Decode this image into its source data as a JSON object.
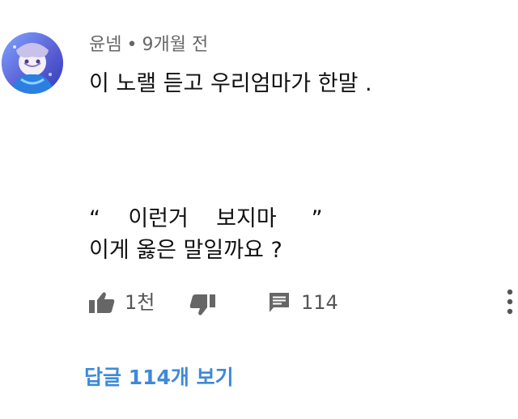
{
  "comment": {
    "author": "윤넴",
    "separator": "•",
    "timestamp": "9개월 전",
    "lines": [
      "이 노랠 듣고 우리엄마가 한말 .",
      "“    이런거    보지마     ”",
      "이게 옳은 말일까요 ?"
    ],
    "likes": "1천",
    "replies": "114",
    "view_replies_label": "답글 114개 보기"
  },
  "icons": {
    "avatar": "user-avatar",
    "like": "thumbs-up-icon",
    "dislike": "thumbs-down-icon",
    "reply": "comment-icon",
    "more": "more-vert-icon"
  },
  "colors": {
    "link": "#3f89d8",
    "meta_text": "#666666",
    "action_icon": "#666666"
  }
}
